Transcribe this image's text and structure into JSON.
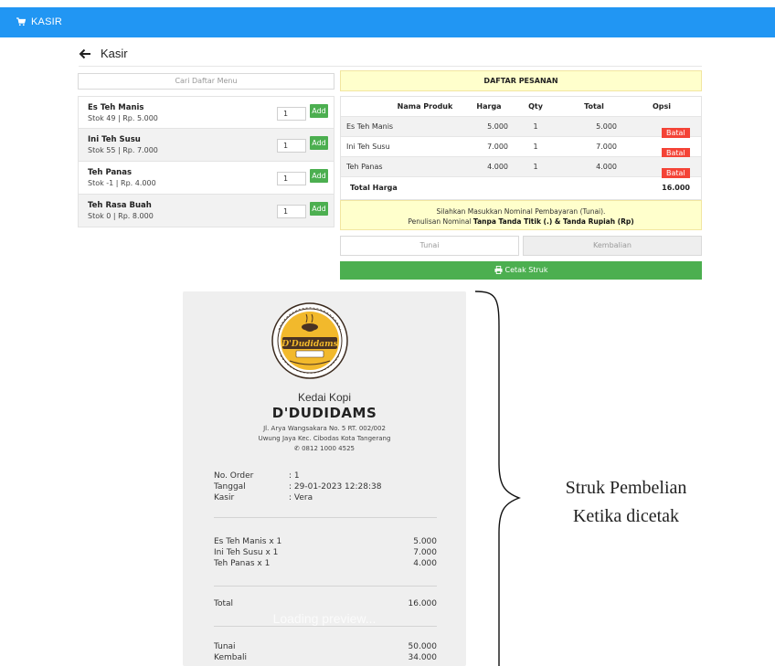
{
  "topbar": {
    "title": "KASIR",
    "icon": "shopping-cart-icon",
    "color": "#2196f3"
  },
  "page": {
    "title": "Kasir",
    "back_icon": "arrow-left-icon"
  },
  "search": {
    "placeholder": "Cari Daftar Menu"
  },
  "menu": [
    {
      "name": "Es Teh Manis",
      "stock": "Stok 49 | Rp. 5.000",
      "qty": "1",
      "button": "Add"
    },
    {
      "name": "Ini Teh Susu",
      "stock": "Stok 55 | Rp. 7.000",
      "qty": "1",
      "button": "Add"
    },
    {
      "name": "Teh Panas",
      "stock": "Stok -1 | Rp. 4.000",
      "qty": "1",
      "button": "Add"
    },
    {
      "name": "Teh Rasa Buah",
      "stock": "Stok 0 | Rp. 8.000",
      "qty": "1",
      "button": "Add"
    }
  ],
  "orders": {
    "header": "DAFTAR PESANAN",
    "columns": [
      "Nama Produk",
      "Harga",
      "Qty",
      "Total",
      "Opsi"
    ],
    "rows": [
      {
        "name": "Es Teh Manis",
        "price": "5.000",
        "qty": "1",
        "total": "5.000",
        "action": "Batal"
      },
      {
        "name": "Ini Teh Susu",
        "price": "7.000",
        "qty": "1",
        "total": "7.000",
        "action": "Batal"
      },
      {
        "name": "Teh Panas",
        "price": "4.000",
        "qty": "1",
        "total": "4.000",
        "action": "Batal"
      }
    ],
    "total_label": "Total Harga",
    "total_value": "16.000"
  },
  "notice": {
    "line1": "Silahkan Masukkan Nominal Pembayaran (Tunai).",
    "line2_prefix": "Penulisan Nominal ",
    "line2_bold": "Tanpa Tanda Titik (.) & Tanda Rupiah (Rp)"
  },
  "payment": {
    "cash_placeholder": "Tunai",
    "change_placeholder": "Kembalian",
    "print_button": "Cetak Struk",
    "print_icon": "printer-icon"
  },
  "receipt": {
    "logo_text": "D'Dudidams",
    "cafe": "Kedai Kopi",
    "brand": "D'DUDIDAMS",
    "address1": "Jl. Arya Wangsakara No. 5 RT. 002/002",
    "address2": "Uwung Jaya Kec. Cibodas Kota Tangerang",
    "phone": "0812 1000 4525",
    "info": [
      {
        "key": "No. Order",
        "value": ": 1"
      },
      {
        "key": "Tanggal",
        "value": ": 29-01-2023 12:28:38"
      },
      {
        "key": "Kasir",
        "value": ": Vera"
      }
    ],
    "items": [
      {
        "label": "Es Teh Manis x 1",
        "value": "5.000"
      },
      {
        "label": "Ini Teh Susu x 1",
        "value": "7.000"
      },
      {
        "label": "Teh Panas x 1",
        "value": "4.000"
      }
    ],
    "total_label": "Total",
    "total_value": "16.000",
    "cash_label": "Tunai",
    "cash_value": "50.000",
    "change_label": "Kembali",
    "change_value": "34.000",
    "overlay": "Loading preview..."
  },
  "caption": {
    "line1": "Struk Pembelian",
    "line2": "Ketika dicetak"
  }
}
